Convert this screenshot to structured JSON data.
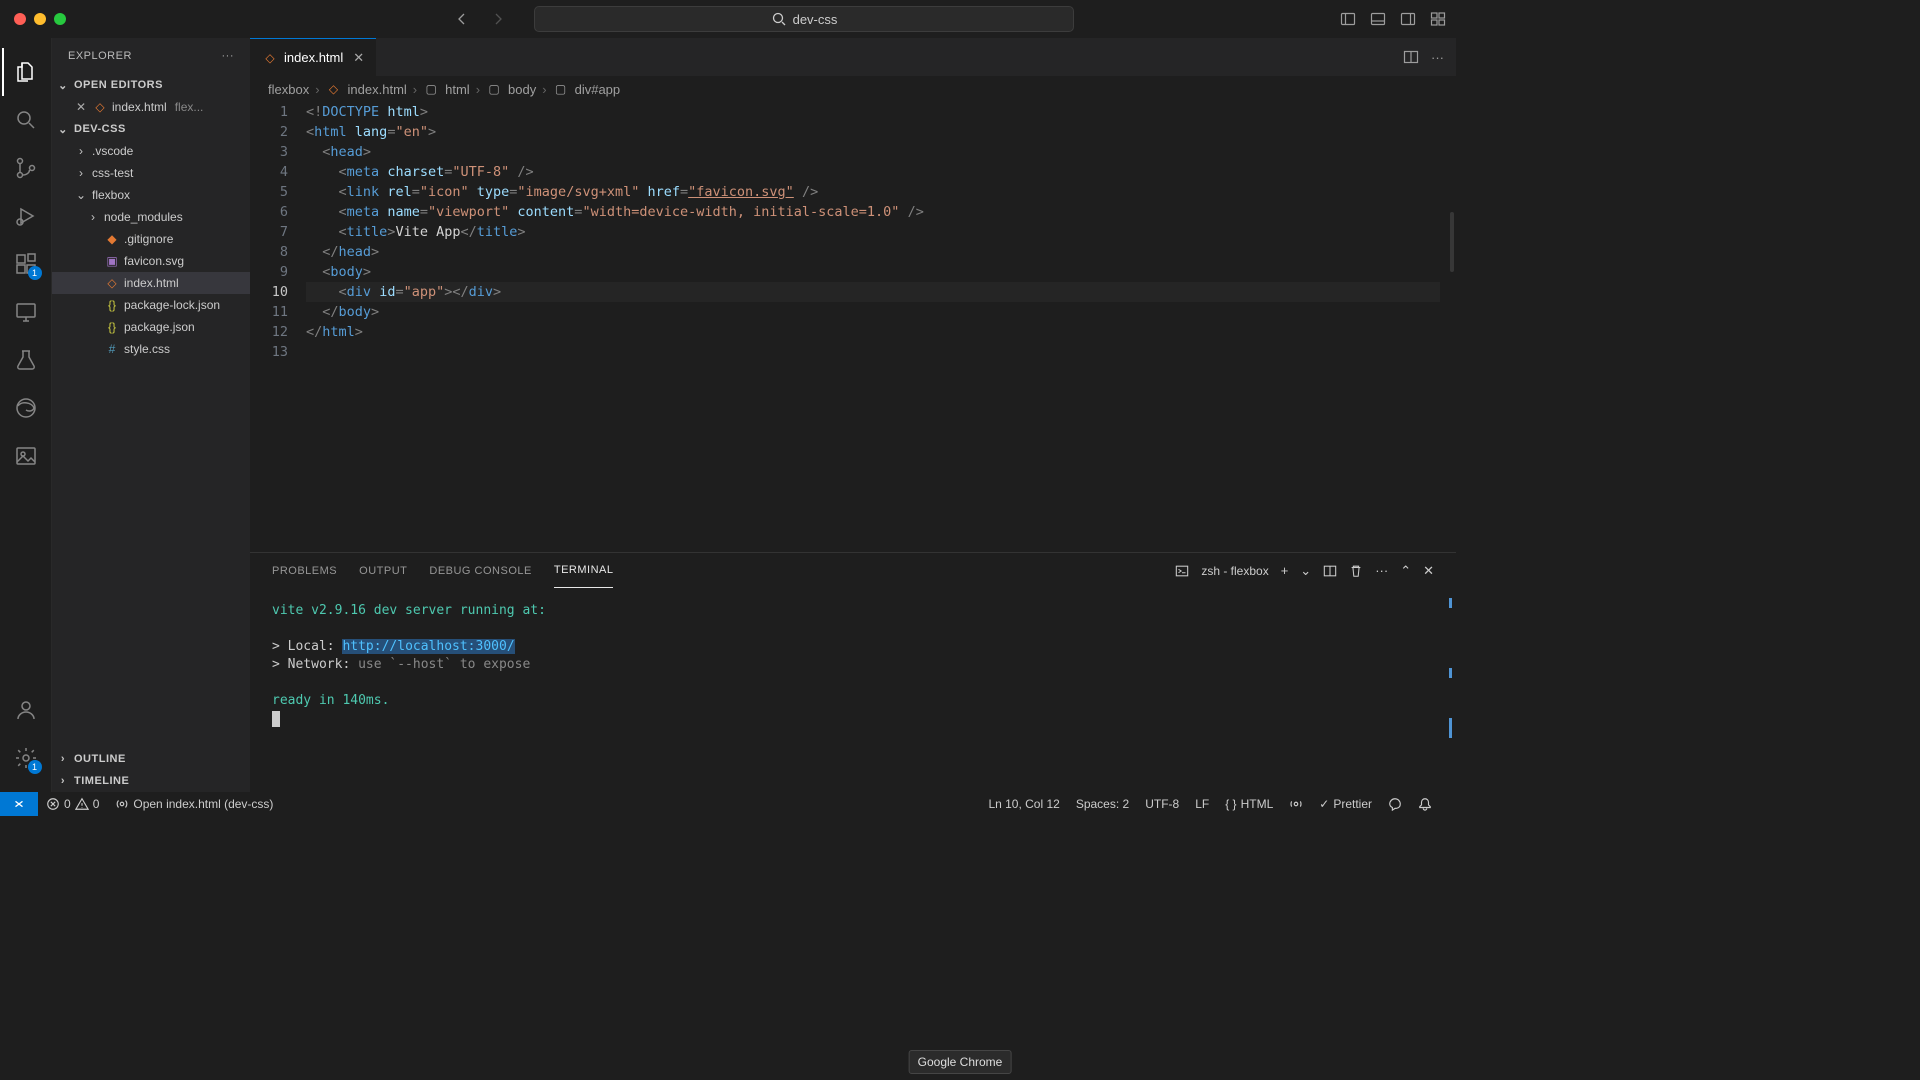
{
  "titlebar": {
    "search_placeholder": "dev-css"
  },
  "sidebar": {
    "title": "EXPLORER",
    "open_editors_label": "OPEN EDITORS",
    "open_editors": [
      {
        "name": "index.html",
        "folder": "flex..."
      }
    ],
    "workspace_label": "DEV-CSS",
    "tree": [
      {
        "name": ".vscode",
        "type": "folder",
        "indent": 1,
        "expanded": false
      },
      {
        "name": "css-test",
        "type": "folder",
        "indent": 1,
        "expanded": false
      },
      {
        "name": "flexbox",
        "type": "folder",
        "indent": 1,
        "expanded": true
      },
      {
        "name": "node_modules",
        "type": "folder",
        "indent": 2,
        "expanded": false
      },
      {
        "name": ".gitignore",
        "type": "git",
        "indent": 2
      },
      {
        "name": "favicon.svg",
        "type": "svg",
        "indent": 2
      },
      {
        "name": "index.html",
        "type": "html",
        "indent": 2,
        "selected": true
      },
      {
        "name": "package-lock.json",
        "type": "json",
        "indent": 2
      },
      {
        "name": "package.json",
        "type": "json",
        "indent": 2
      },
      {
        "name": "style.css",
        "type": "css",
        "indent": 2
      }
    ],
    "outline_label": "OUTLINE",
    "timeline_label": "TIMELINE"
  },
  "activity": {
    "ext_badge": "1",
    "settings_badge": "1"
  },
  "tab": {
    "name": "index.html"
  },
  "breadcrumb": {
    "parts": [
      "flexbox",
      "index.html",
      "html",
      "body",
      "div#app"
    ]
  },
  "editor": {
    "line_count": 13,
    "current_line": 10,
    "lines": [
      [
        [
          "punc",
          "<!"
        ],
        [
          "doctype",
          "DOCTYPE"
        ],
        [
          "text",
          " "
        ],
        [
          "attr",
          "html"
        ],
        [
          "punc",
          ">"
        ]
      ],
      [
        [
          "punc",
          "<"
        ],
        [
          "tag",
          "html"
        ],
        [
          "text",
          " "
        ],
        [
          "attr",
          "lang"
        ],
        [
          "punc",
          "="
        ],
        [
          "str",
          "\"en\""
        ],
        [
          "punc",
          ">"
        ]
      ],
      [
        [
          "text",
          "  "
        ],
        [
          "punc",
          "<"
        ],
        [
          "tag",
          "head"
        ],
        [
          "punc",
          ">"
        ]
      ],
      [
        [
          "text",
          "    "
        ],
        [
          "punc",
          "<"
        ],
        [
          "tag",
          "meta"
        ],
        [
          "text",
          " "
        ],
        [
          "attr",
          "charset"
        ],
        [
          "punc",
          "="
        ],
        [
          "str",
          "\"UTF-8\""
        ],
        [
          "text",
          " "
        ],
        [
          "punc",
          "/>"
        ]
      ],
      [
        [
          "text",
          "    "
        ],
        [
          "punc",
          "<"
        ],
        [
          "tag",
          "link"
        ],
        [
          "text",
          " "
        ],
        [
          "attr",
          "rel"
        ],
        [
          "punc",
          "="
        ],
        [
          "str",
          "\"icon\""
        ],
        [
          "text",
          " "
        ],
        [
          "attr",
          "type"
        ],
        [
          "punc",
          "="
        ],
        [
          "str",
          "\"image/svg+xml\""
        ],
        [
          "text",
          " "
        ],
        [
          "attr",
          "href"
        ],
        [
          "punc",
          "="
        ],
        [
          "strlink",
          "\"favicon.svg\""
        ],
        [
          "text",
          " "
        ],
        [
          "punc",
          "/>"
        ]
      ],
      [
        [
          "text",
          "    "
        ],
        [
          "punc",
          "<"
        ],
        [
          "tag",
          "meta"
        ],
        [
          "text",
          " "
        ],
        [
          "attr",
          "name"
        ],
        [
          "punc",
          "="
        ],
        [
          "str",
          "\"viewport\""
        ],
        [
          "text",
          " "
        ],
        [
          "attr",
          "content"
        ],
        [
          "punc",
          "="
        ],
        [
          "str",
          "\"width=device-width, initial-scale=1.0\""
        ],
        [
          "text",
          " "
        ],
        [
          "punc",
          "/>"
        ]
      ],
      [
        [
          "text",
          "    "
        ],
        [
          "punc",
          "<"
        ],
        [
          "tag",
          "title"
        ],
        [
          "punc",
          ">"
        ],
        [
          "text",
          "Vite App"
        ],
        [
          "punc",
          "</"
        ],
        [
          "tag",
          "title"
        ],
        [
          "punc",
          ">"
        ]
      ],
      [
        [
          "text",
          "  "
        ],
        [
          "punc",
          "</"
        ],
        [
          "tag",
          "head"
        ],
        [
          "punc",
          ">"
        ]
      ],
      [
        [
          "text",
          "  "
        ],
        [
          "punc",
          "<"
        ],
        [
          "tag",
          "body"
        ],
        [
          "punc",
          ">"
        ]
      ],
      [
        [
          "text",
          "    "
        ],
        [
          "punc",
          "<"
        ],
        [
          "tag",
          "div"
        ],
        [
          "text",
          " "
        ],
        [
          "attr",
          "id"
        ],
        [
          "punc",
          "="
        ],
        [
          "str",
          "\"app\""
        ],
        [
          "punc",
          "></"
        ],
        [
          "tag",
          "div"
        ],
        [
          "punc",
          ">"
        ]
      ],
      [
        [
          "text",
          "  "
        ],
        [
          "punc",
          "</"
        ],
        [
          "tag",
          "body"
        ],
        [
          "punc",
          ">"
        ]
      ],
      [
        [
          "punc",
          "</"
        ],
        [
          "tag",
          "html"
        ],
        [
          "punc",
          ">"
        ]
      ],
      []
    ]
  },
  "panel": {
    "tabs": [
      "PROBLEMS",
      "OUTPUT",
      "DEBUG CONSOLE",
      "TERMINAL"
    ],
    "active_tab": 3,
    "terminal_name": "zsh - flexbox",
    "terminal_lines": [
      {
        "cls": "term-green",
        "text": "vite v2.9.16 dev server running at:"
      },
      {
        "cls": "",
        "text": ""
      },
      {
        "cls": "",
        "prefix": "> Local:   ",
        "link": "http://localhost:3000/",
        "link_trail": " "
      },
      {
        "cls": "",
        "prefix": "> Network: ",
        "gray": "use `--host` to expose"
      },
      {
        "cls": "",
        "text": ""
      },
      {
        "cls": "term-green",
        "text": "ready in 140ms."
      }
    ]
  },
  "status": {
    "errors": "0",
    "warnings": "0",
    "open_label": "Open index.html (dev-css)",
    "ln_col": "Ln 10, Col 12",
    "spaces": "Spaces: 2",
    "encoding": "UTF-8",
    "eol": "LF",
    "language": "HTML",
    "prettier": "Prettier"
  },
  "tooltip": "Google Chrome"
}
